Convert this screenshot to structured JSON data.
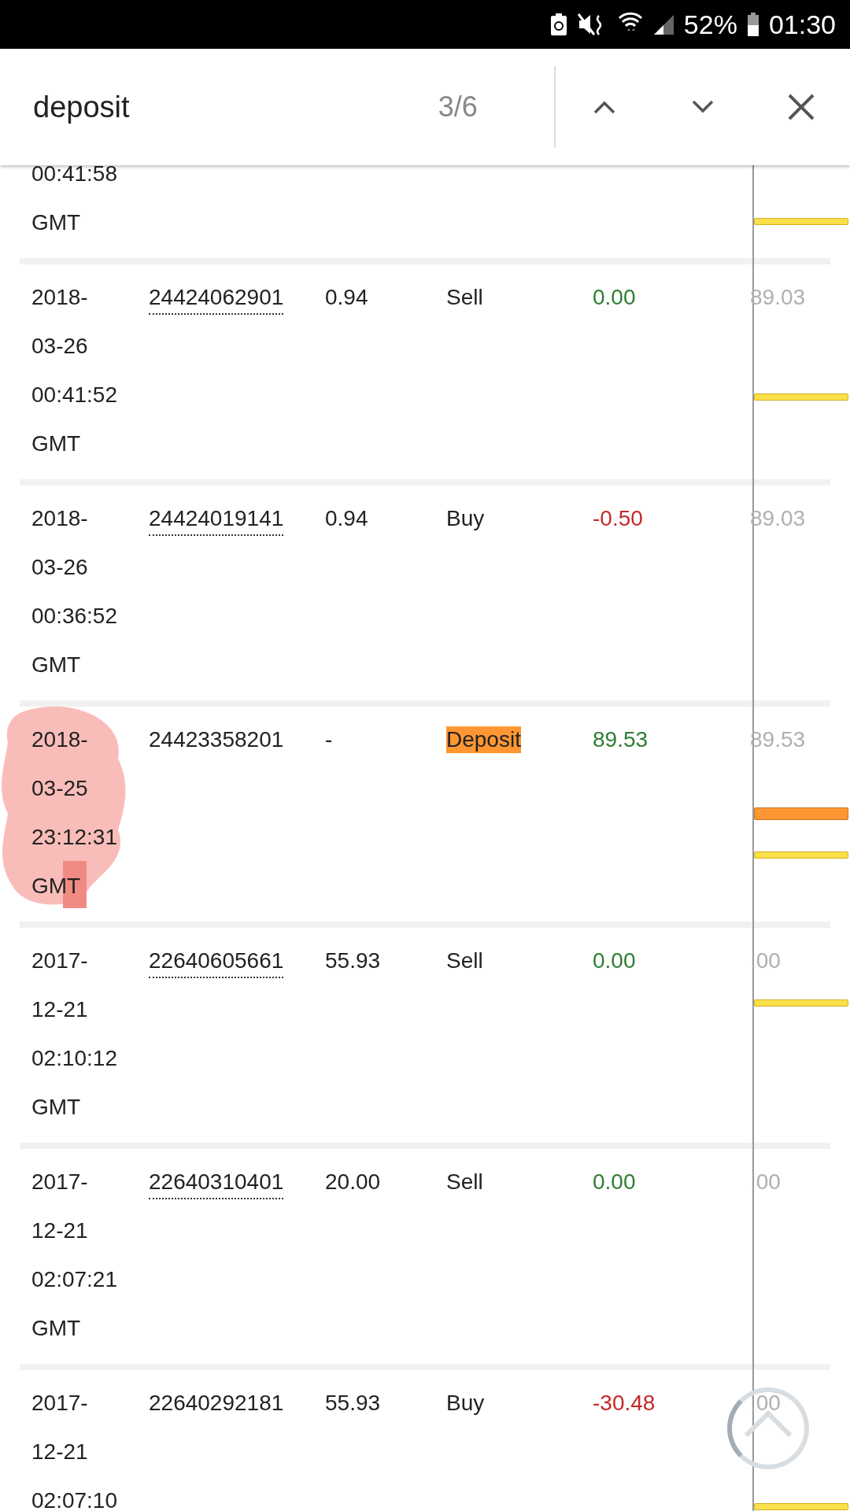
{
  "status_bar": {
    "battery": "52%",
    "time": "01:30"
  },
  "find_bar": {
    "query": "deposit",
    "match_count": "3/6"
  },
  "match_markers": [
    {
      "selected": false
    },
    {
      "selected": false
    },
    {
      "selected": true
    },
    {
      "selected": false
    },
    {
      "selected": false
    },
    {
      "selected": false
    }
  ],
  "rows": [
    {
      "date": [
        "00:41:58",
        "GMT"
      ]
    },
    {
      "date": [
        "2018-",
        "03-26",
        "00:41:52",
        "GMT"
      ],
      "id": "24424062901",
      "linked": true,
      "price": "0.94",
      "type": "Sell",
      "highlighted": false,
      "amount": "0.00",
      "color": "#2e7d32",
      "balance": "89.03",
      "redacted": false
    },
    {
      "date": [
        "2018-",
        "03-26",
        "00:36:52",
        "GMT"
      ],
      "id": "24424019141",
      "linked": true,
      "price": "0.94",
      "type": "Buy",
      "highlighted": false,
      "amount": "-0.50",
      "color": "#c62828",
      "balance": "89.03",
      "redacted": false
    },
    {
      "date": [
        "2018-",
        "03-25",
        "23:12:31",
        "GMT"
      ],
      "id": "24423358201",
      "linked": false,
      "price": "-",
      "type": "Deposit",
      "highlighted": true,
      "amount": "89.53",
      "color": "#2e7d32",
      "balance": "89.53",
      "redacted": true
    },
    {
      "date": [
        "2017-",
        "12-21",
        "02:10:12",
        "GMT"
      ],
      "id": "22640605661",
      "linked": true,
      "price": "55.93",
      "type": "Sell",
      "highlighted": false,
      "amount": "0.00",
      "color": "#2e7d32",
      "balance": ".00",
      "redacted": false
    },
    {
      "date": [
        "2017-",
        "12-21",
        "02:07:21",
        "GMT"
      ],
      "id": "22640310401",
      "linked": true,
      "price": "20.00",
      "type": "Sell",
      "highlighted": false,
      "amount": "0.00",
      "color": "#2e7d32",
      "balance": ".00",
      "redacted": false
    },
    {
      "date": [
        "2017-",
        "12-21",
        "02:07:10"
      ],
      "id": "22640292181",
      "linked": false,
      "price": "55.93",
      "type": "Buy",
      "highlighted": false,
      "amount": "-30.48",
      "color": "#c62828",
      "balance": ".00",
      "redacted": false
    }
  ]
}
